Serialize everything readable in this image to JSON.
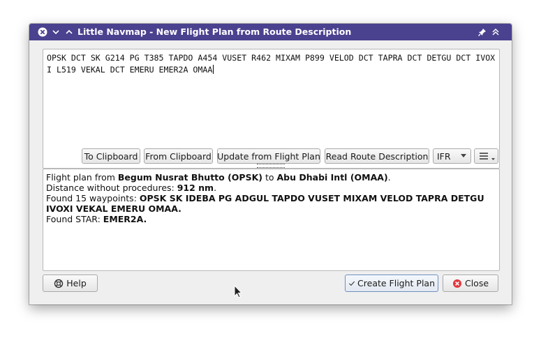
{
  "window": {
    "title": "Little Navmap - New Flight Plan from Route Description"
  },
  "route_description": {
    "text": "OPSK DCT SK G214 PG T385 TAPDO A454 VUSET R462 MIXAM P899 VELOD DCT TAPRA DCT DETGU DCT IVOXI L519 VEKAL DCT EMERU EMER2A OMAA"
  },
  "toolbar": {
    "to_clipboard": "To Clipboard",
    "from_clipboard": "From Clipboard",
    "update_from_plan": "Update from Flight Plan",
    "read_route": "Read Route Description",
    "flight_rules": {
      "selected": "IFR"
    }
  },
  "info": {
    "line1_prefix": "Flight plan from ",
    "departure": "Begum Nusrat Bhutto (OPSK)",
    "line1_mid": " to ",
    "destination": "Abu Dhabi Intl (OMAA)",
    "line1_suffix": ".",
    "distance_label": "Distance without procedures: ",
    "distance_value": "912 nm",
    "distance_suffix": ".",
    "waypoints_label": "Found 15 waypoints: ",
    "waypoints_value": "OPSK SK IDEBA PG ADGUL TAPDO VUSET MIXAM VELOD TAPRA DETGU IVOXI VEKAL EMERU OMAA.",
    "star_label": "Found STAR: ",
    "star_value": "EMER2A."
  },
  "buttons": {
    "help": "Help",
    "create": "Create Flight Plan",
    "close": "Close"
  },
  "colors": {
    "titlebar": "#4a418f",
    "close_icon": "#e0383e"
  }
}
